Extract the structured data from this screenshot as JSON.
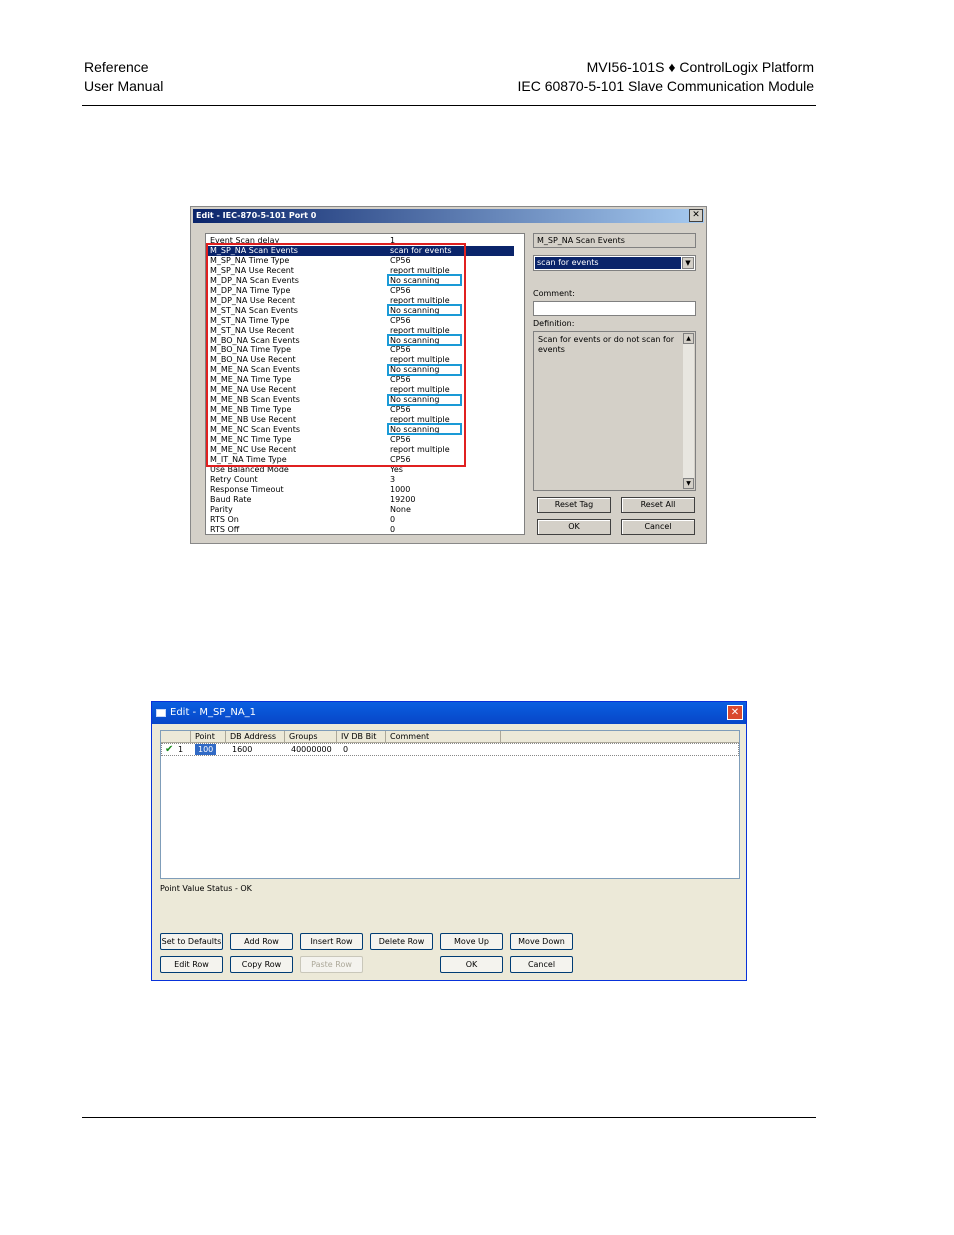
{
  "header": {
    "left_line1": "Reference",
    "left_line2": "User Manual",
    "right_line1": "MVI56-101S ♦ ControlLogix Platform",
    "right_line2": "IEC 60870-5-101 Slave Communication Module"
  },
  "dialog1": {
    "title": "Edit - IEC-870-5-101 Port 0",
    "close": "✕",
    "rows": [
      {
        "name": "Event Scan delay",
        "value": "1"
      },
      {
        "name": "M_SP_NA Scan Events",
        "value": "scan for events"
      },
      {
        "name": "M_SP_NA Time Type",
        "value": "CP56"
      },
      {
        "name": "M_SP_NA Use Recent",
        "value": "report multiple"
      },
      {
        "name": "M_DP_NA Scan Events",
        "value": "No scanning"
      },
      {
        "name": "M_DP_NA Time Type",
        "value": "CP56"
      },
      {
        "name": "M_DP_NA Use Recent",
        "value": "report multiple"
      },
      {
        "name": "M_ST_NA Scan Events",
        "value": "No scanning"
      },
      {
        "name": "M_ST_NA Time Type",
        "value": "CP56"
      },
      {
        "name": "M_ST_NA Use Recent",
        "value": "report multiple"
      },
      {
        "name": "M_BO_NA Scan Events",
        "value": "No scanning"
      },
      {
        "name": "M_BO_NA Time Type",
        "value": "CP56"
      },
      {
        "name": "M_BO_NA Use Recent",
        "value": "report multiple"
      },
      {
        "name": "M_ME_NA Scan Events",
        "value": "No scanning"
      },
      {
        "name": "M_ME_NA Time Type",
        "value": "CP56"
      },
      {
        "name": "M_ME_NA Use Recent",
        "value": "report multiple"
      },
      {
        "name": "M_ME_NB Scan Events",
        "value": "No scanning"
      },
      {
        "name": "M_ME_NB Time Type",
        "value": "CP56"
      },
      {
        "name": "M_ME_NB Use Recent",
        "value": "report multiple"
      },
      {
        "name": "M_ME_NC Scan Events",
        "value": "No scanning"
      },
      {
        "name": "M_ME_NC Time Type",
        "value": "CP56"
      },
      {
        "name": "M_ME_NC Use Recent",
        "value": "report multiple"
      },
      {
        "name": "M_IT_NA Time Type",
        "value": "CP56"
      },
      {
        "name": "Use Balanced Mode",
        "value": "Yes"
      },
      {
        "name": "Retry Count",
        "value": "3"
      },
      {
        "name": "Response Timeout",
        "value": "1000"
      },
      {
        "name": "Baud Rate",
        "value": "19200"
      },
      {
        "name": "Parity",
        "value": "None"
      },
      {
        "name": "RTS On",
        "value": "0"
      },
      {
        "name": "RTS Off",
        "value": "0"
      }
    ],
    "field_name": "M_SP_NA Scan Events",
    "selected_value": "scan for events",
    "comment_label": "Comment:",
    "comment_value": "",
    "definition_label": "Definition:",
    "definition_text": "Scan for events or do not scan for events",
    "buttons": {
      "reset_tag": "Reset Tag",
      "reset_all": "Reset All",
      "ok": "OK",
      "cancel": "Cancel"
    }
  },
  "dialog2": {
    "title": "Edit - M_SP_NA_1",
    "close": "✕",
    "columns": [
      "Point",
      "DB Address",
      "Groups",
      "IV DB Bit",
      "Comment"
    ],
    "rows": [
      {
        "check": "✔",
        "index": "1",
        "point": "100",
        "db_address": "1600",
        "groups": "40000000",
        "iv_db_bit": "0",
        "comment": ""
      }
    ],
    "status": "Point Value Status - OK",
    "buttons": {
      "set_to_defaults": "Set to Defaults",
      "add_row": "Add Row",
      "insert_row": "Insert Row",
      "delete_row": "Delete Row",
      "move_up": "Move Up",
      "move_down": "Move Down",
      "edit_row": "Edit Row",
      "copy_row": "Copy Row",
      "paste_row": "Paste Row",
      "ok": "OK",
      "cancel": "Cancel"
    }
  }
}
